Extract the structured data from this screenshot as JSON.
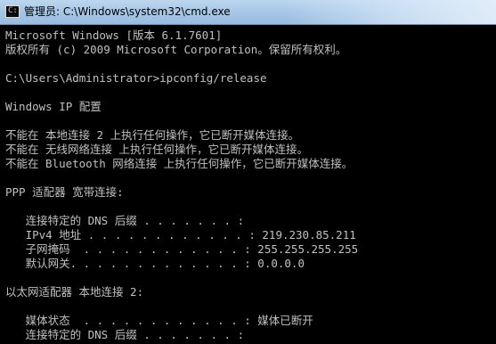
{
  "window": {
    "title": "管理员: C:\\Windows\\system32\\cmd.exe",
    "icon": "cmd-icon"
  },
  "console": {
    "lines": [
      "Microsoft Windows [版本 6.1.7601]",
      "版权所有 (c) 2009 Microsoft Corporation。保留所有权利。",
      "",
      "C:\\Users\\Administrator>ipconfig/release",
      "",
      "Windows IP 配置",
      "",
      "不能在 本地连接 2 上执行任何操作，它已断开媒体连接。",
      "不能在 无线网络连接 上执行任何操作，它已断开媒体连接。",
      "不能在 Bluetooth 网络连接 上执行任何操作，它已断开媒体连接。",
      "",
      "PPP 适配器 宽带连接:",
      "",
      "   连接特定的 DNS 后缀 . . . . . . . :",
      "   IPv4 地址 . . . . . . . . . . . . : 219.230.85.211",
      "   子网掩码  . . . . . . . . . . . . : 255.255.255.255",
      "   默认网关. . . . . . . . . . . . . : 0.0.0.0",
      "",
      "以太网适配器 本地连接 2:",
      "",
      "   媒体状态  . . . . . . . . . . . . : 媒体已断开",
      "   连接特定的 DNS 后缀 . . . . . . . :"
    ]
  }
}
